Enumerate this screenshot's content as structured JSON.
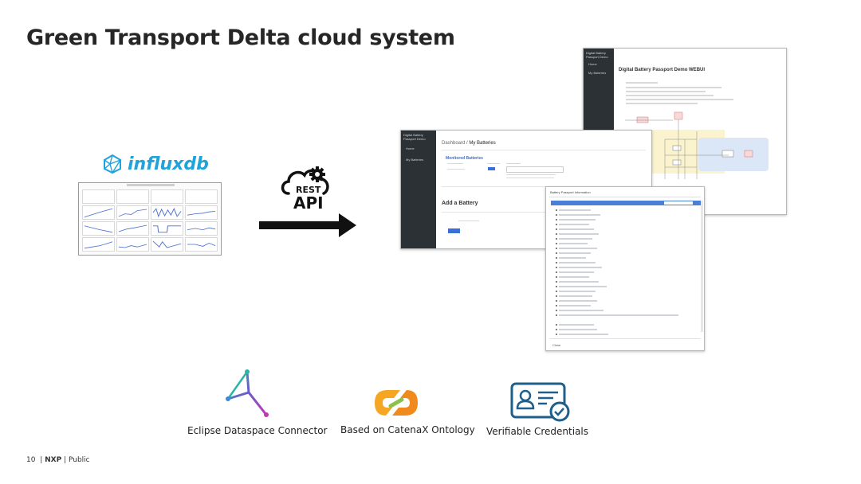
{
  "slide": {
    "title": "Green Transport Delta cloud system"
  },
  "influxdb": {
    "logo_text": "influxdb",
    "icon": "influxdb-logo-icon"
  },
  "rest_api": {
    "line1": "REST",
    "line2": "API",
    "icon": "cloud-gear-icon"
  },
  "webui_main": {
    "sidebar_title": "Digital Battery Passport Demo",
    "sidebar_items": [
      "Home",
      "My Batteries"
    ],
    "heading": "Digital Battery Passport Demo WEBUI"
  },
  "batteries_page": {
    "sidebar_title": "Digital Battery Passport Demo",
    "sidebar_items": [
      "Home",
      "My Batteries"
    ],
    "breadcrumb_root": "Dashboard",
    "breadcrumb_sep": "/",
    "breadcrumb_current": "My Batteries",
    "section_title": "Monitored Batteries",
    "section2_title": "Add a Battery"
  },
  "schema_dialog": {
    "title": "Battery Passport Information",
    "close_label": "Close"
  },
  "bottom": {
    "logos": [
      {
        "label": "Eclipse Dataspace Connector",
        "icon": "eclipse-dataspace-connector-icon"
      },
      {
        "label": "Based on CatenaX Ontology",
        "icon": "catenax-logo-icon"
      },
      {
        "label": "Verifiable Credentials",
        "icon": "verifiable-credential-icon"
      }
    ]
  },
  "footer": {
    "page": "10",
    "sep": "|",
    "company": "NXP",
    "classification": "Public"
  },
  "colors": {
    "influx_blue": "#21a2d9",
    "sidebar_dark": "#2c3136",
    "ui_blue": "#3b6fd8",
    "catenax_orange": "#f5a623",
    "credential_blue": "#1f5f8b"
  }
}
